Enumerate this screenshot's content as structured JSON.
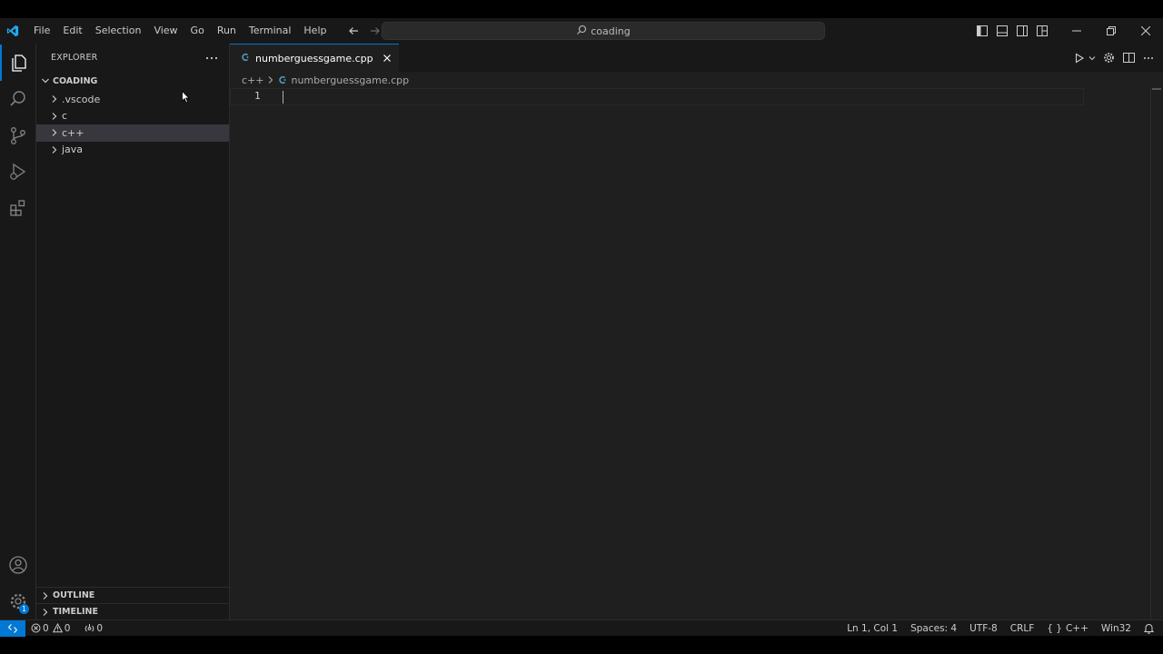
{
  "titlebar": {
    "menu": [
      "File",
      "Edit",
      "Selection",
      "View",
      "Go",
      "Run",
      "Terminal",
      "Help"
    ],
    "search_text": "coading"
  },
  "sidebar": {
    "header": "EXPLORER",
    "root": "COADING",
    "items": [
      ".vscode",
      "c",
      "c++",
      "java"
    ],
    "outline": "OUTLINE",
    "timeline": "TIMELINE"
  },
  "editor": {
    "tab_label": "numberguessgame.cpp",
    "breadcrumb": {
      "folder": "c++",
      "file": "numberguessgame.cpp"
    },
    "line_number": "1"
  },
  "status": {
    "errors": "0",
    "warnings": "0",
    "ports": "0",
    "position": "Ln 1, Col 1",
    "spaces": "Spaces: 4",
    "encoding": "UTF-8",
    "eol": "CRLF",
    "language": "C++",
    "platform": "Win32",
    "accounts_badge": "1"
  },
  "colors": {
    "accent": "#0078d4",
    "vscode_logo": "#23a9f2",
    "cpp_icon": "#519aba"
  }
}
